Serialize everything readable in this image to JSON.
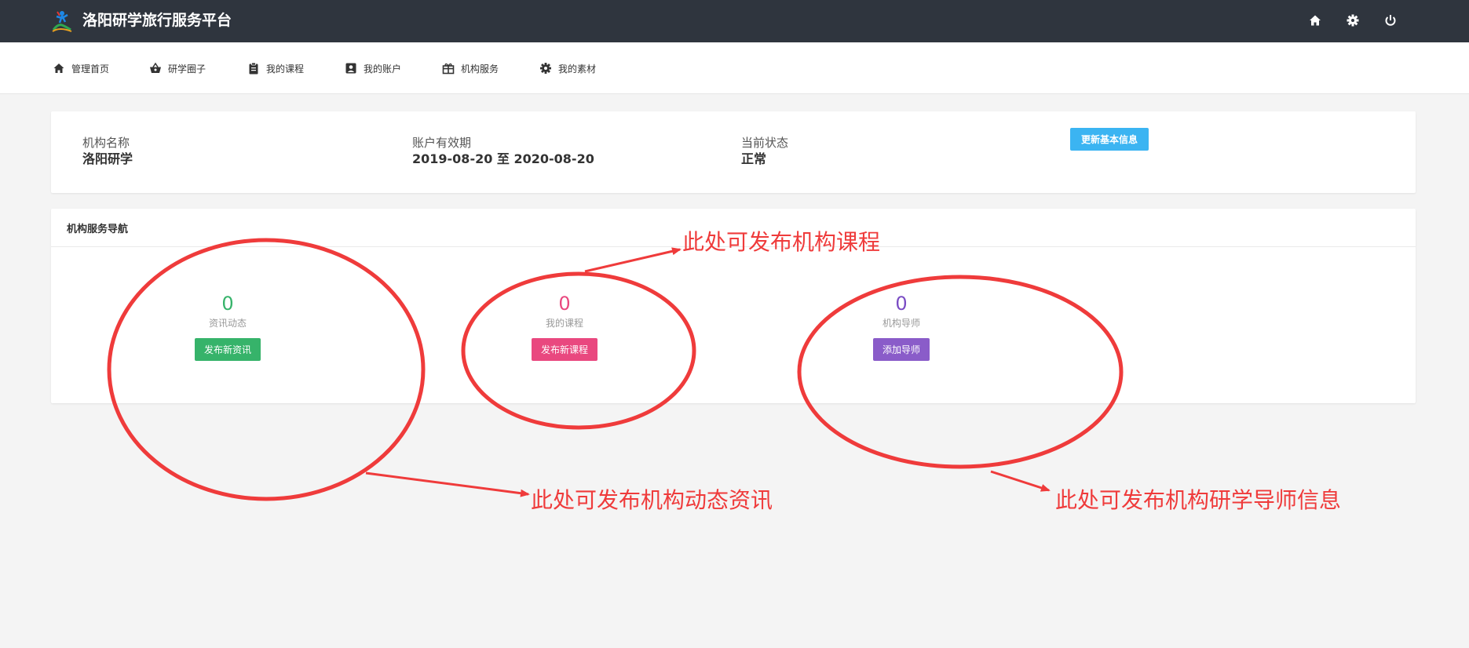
{
  "header": {
    "app_title": "洛阳研学旅行服务平台",
    "icons": [
      "home-icon",
      "gear-icon",
      "power-icon"
    ]
  },
  "nav": {
    "items": [
      {
        "label": "管理首页",
        "icon": "home-icon"
      },
      {
        "label": "研学圈子",
        "icon": "basket-icon"
      },
      {
        "label": "我的课程",
        "icon": "clipboard-icon"
      },
      {
        "label": "我的账户",
        "icon": "account-box-icon"
      },
      {
        "label": "机构服务",
        "icon": "gift-icon"
      },
      {
        "label": "我的素材",
        "icon": "gear-icon"
      }
    ]
  },
  "info": {
    "org_name_label": "机构名称",
    "org_name_value": "洛阳研学",
    "validity_label": "账户有效期",
    "validity_value": "2019-08-20 至 2020-08-20",
    "status_label": "当前状态",
    "status_value": "正常",
    "update_button": "更新基本信息"
  },
  "service": {
    "title": "机构服务导航",
    "stats": [
      {
        "count": "0",
        "label": "资讯动态",
        "button": "发布新资讯",
        "color": "#36b36a"
      },
      {
        "count": "0",
        "label": "我的课程",
        "button": "发布新课程",
        "color": "#e9487f"
      },
      {
        "count": "0",
        "label": "机构导师",
        "button": "添加导师",
        "color": "#7a4cc4"
      }
    ]
  },
  "annotations": {
    "course": "此处可发布机构课程",
    "news": "此处可发布机构动态资讯",
    "mentor": "此处可发布机构研学导师信息",
    "color": "#ef3b3b"
  }
}
